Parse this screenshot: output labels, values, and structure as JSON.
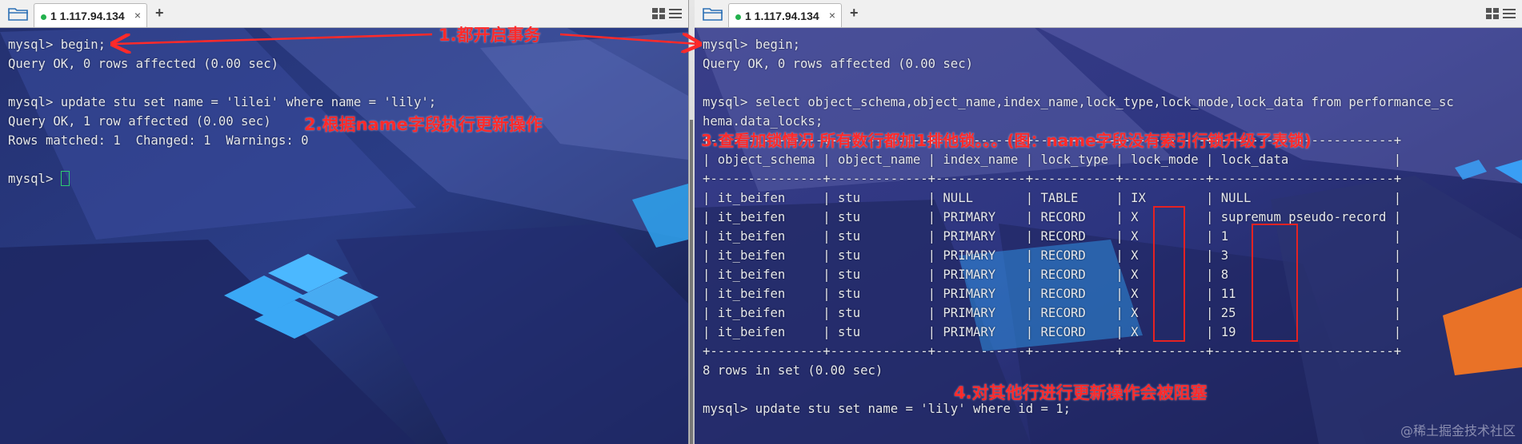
{
  "left": {
    "tab": {
      "label": "1 1.117.94.134",
      "close": "×",
      "status_color": "#23b14d"
    },
    "add_tab": "+",
    "lines": [
      "mysql> begin;",
      "Query OK, 0 rows affected (0.00 sec)",
      "",
      "mysql> update stu set name = 'lilei' where name = 'lily';",
      "Query OK, 1 row affected (0.00 sec)",
      "Rows matched: 1  Changed: 1  Warnings: 0",
      "",
      "mysql> "
    ]
  },
  "right": {
    "tab": {
      "label": "1 1.117.94.134",
      "close": "×",
      "status_color": "#23b14d"
    },
    "add_tab": "+",
    "lines": [
      "mysql> begin;",
      "Query OK, 0 rows affected (0.00 sec)",
      "",
      "mysql> select object_schema,object_name,index_name,lock_type,lock_mode,lock_data from performance_sc",
      "hema.data_locks;",
      "+---------------+-------------+------------+-----------+-----------+------------------------+",
      "| object_schema | object_name | index_name | lock_type | lock_mode | lock_data              |",
      "+---------------+-------------+------------+-----------+-----------+------------------------+",
      "| it_beifen     | stu         | NULL       | TABLE     | IX        | NULL                   |",
      "| it_beifen     | stu         | PRIMARY    | RECORD    | X         | supremum pseudo-record |",
      "| it_beifen     | stu         | PRIMARY    | RECORD    | X         | 1                      |",
      "| it_beifen     | stu         | PRIMARY    | RECORD    | X         | 3                      |",
      "| it_beifen     | stu         | PRIMARY    | RECORD    | X         | 8                      |",
      "| it_beifen     | stu         | PRIMARY    | RECORD    | X         | 11                     |",
      "| it_beifen     | stu         | PRIMARY    | RECORD    | X         | 25                     |",
      "| it_beifen     | stu         | PRIMARY    | RECORD    | X         | 19                     |",
      "+---------------+-------------+------------+-----------+-----------+------------------------+",
      "8 rows in set (0.00 sec)",
      "",
      "mysql> update stu set name = 'lily' where id = 1;"
    ]
  },
  "annotations": {
    "a1": "1.都开启事务",
    "a2": "2.根据name字段执行更新操作",
    "a3": "3.查看加锁情况 所有数行都加1排他锁。。。(图：name字段没有索引行锁升级了表锁)",
    "a4": "4.对其他行进行更新操作会被阻塞"
  },
  "watermark": "@稀土掘金技术社区",
  "colors": {
    "annotation": "#ff2a2a",
    "terminal_text": "#e6e8ec",
    "cursor": "#2ecc71"
  }
}
